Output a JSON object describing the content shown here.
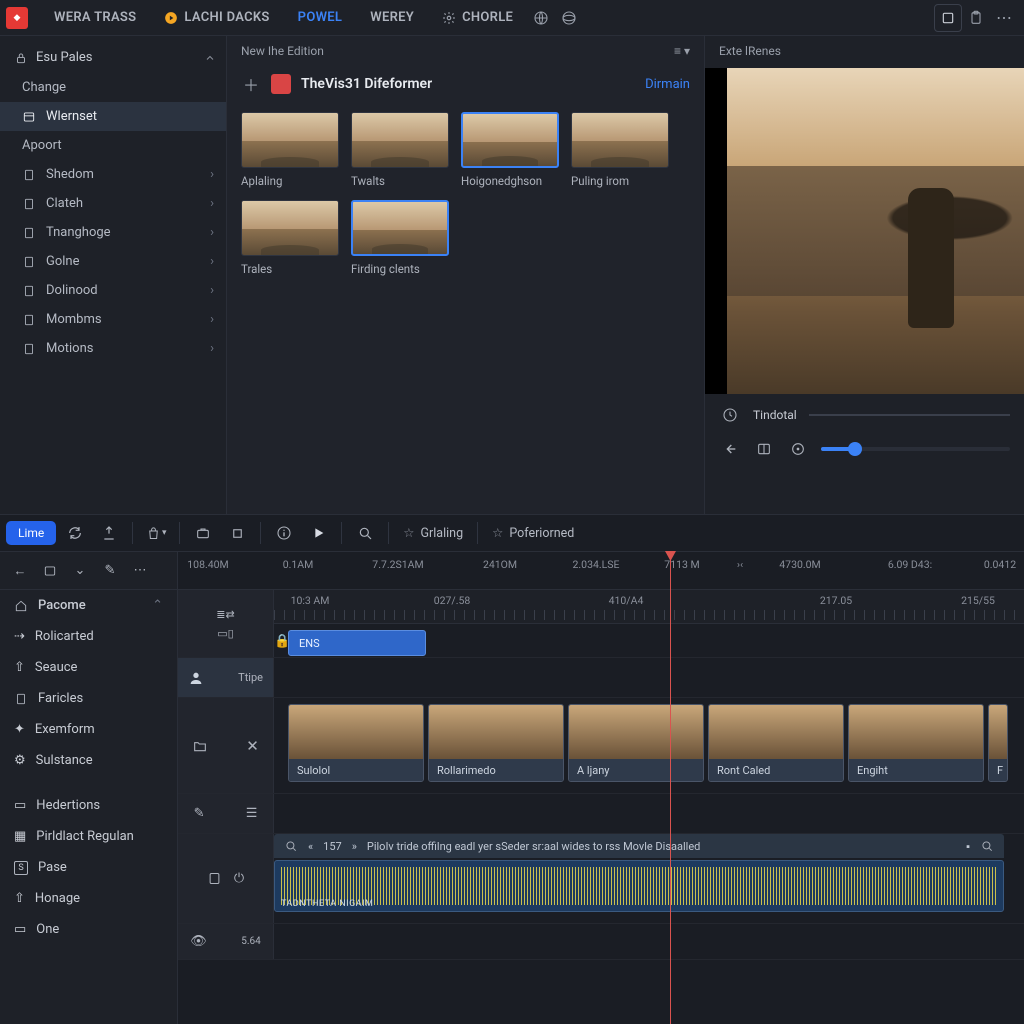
{
  "topbar": {
    "tabs": [
      "WERA TRASS",
      "LACHI DACKS",
      "POWEL",
      "WEREY",
      "CHORLE"
    ],
    "active_index": 2
  },
  "sidebar": {
    "header": "Esu Pales",
    "items": [
      {
        "label": "Change",
        "icon": "none"
      },
      {
        "label": "Wlernset",
        "icon": "panel",
        "selected": true
      },
      {
        "label": "Apoort",
        "icon": "none"
      },
      {
        "label": "Shedom",
        "icon": "doc",
        "chev": true
      },
      {
        "label": "Clateh",
        "icon": "doc",
        "chev": true
      },
      {
        "label": "Tnanghoge",
        "icon": "doc",
        "chev": true
      },
      {
        "label": "Golne",
        "icon": "doc",
        "chev": true
      },
      {
        "label": "Dolinood",
        "icon": "doc",
        "chev": true
      },
      {
        "label": "Mombms",
        "icon": "doc",
        "chev": true
      },
      {
        "label": "Motions",
        "icon": "doc",
        "chev": true
      }
    ]
  },
  "media": {
    "header": "New Ihe Edition",
    "title": "TheVis31 Difeformer",
    "link": "Dirmain",
    "thumbs": [
      {
        "label": "Aplaling"
      },
      {
        "label": "Twalts"
      },
      {
        "label": "Hoigonedghson",
        "selected": true
      },
      {
        "label": "Puling irom"
      },
      {
        "label": "Trales"
      },
      {
        "label": "Firding clents",
        "selected": true
      }
    ]
  },
  "preview": {
    "header": "Exte lRenes",
    "timelabel": "Tindotal"
  },
  "tltoolbar": {
    "blue": "Lime",
    "grl": "Grlaling",
    "pof": "Poferiorned"
  },
  "ruler_top": [
    "108.40M",
    "0.1AM",
    "7.7.2S1AM",
    "241OM",
    "2.034.LSE",
    "7113 M",
    "4730.0M",
    "6.09 D43:",
    "0.0412"
  ],
  "ruler_sub": [
    "10:3 AM",
    "027/.58",
    "410/A4",
    "217.05",
    "215/55"
  ],
  "clip_text": "ENS",
  "vclips": [
    "Sulolol",
    "Rollarimedo",
    "A ljany",
    "Ront Caled",
    "Engiht"
  ],
  "track_thead": "Ttipe",
  "audio": {
    "bar_num": "157",
    "bar_text": "PiloIv tride offilng eadl yer sSeder sr:aal wides to rss Movle Disaalled",
    "wave_label": "TADNTHETA   NIGAIM",
    "left_num": "5.64"
  },
  "tl_left": {
    "top_icons": [
      "back",
      "panel",
      "chev",
      "pen",
      "dots"
    ],
    "groups": [
      {
        "label": "Pacome",
        "icon": "home",
        "hdr": true,
        "chev": true
      },
      {
        "label": "Rolicarted",
        "icon": "share"
      },
      {
        "label": "Seauce",
        "icon": "up"
      },
      {
        "label": "Faricles",
        "icon": "doc"
      },
      {
        "label": "Exemform",
        "icon": "star"
      },
      {
        "label": "Sulstance",
        "icon": "gear"
      },
      {
        "label": "Hedertions",
        "icon": "case",
        "spacer": true
      },
      {
        "label": "Pirldlact Regulan",
        "icon": "grid"
      },
      {
        "label": "Pase",
        "icon": "s"
      },
      {
        "label": "Honage",
        "icon": "up"
      },
      {
        "label": "One",
        "icon": "case"
      }
    ]
  }
}
